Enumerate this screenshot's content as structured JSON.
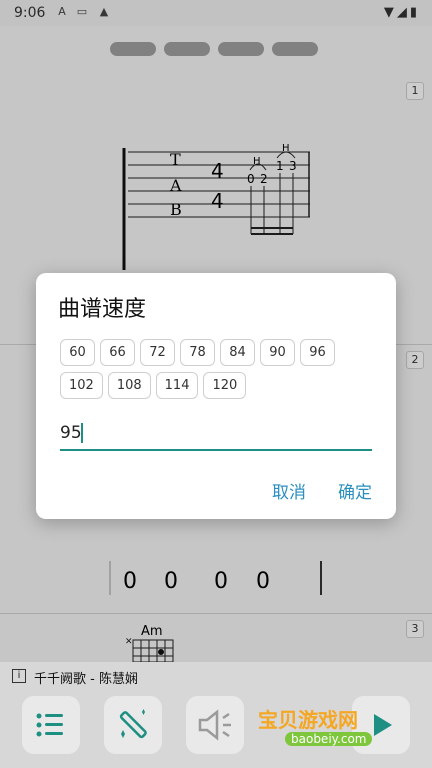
{
  "status": {
    "time": "9:06"
  },
  "pages": [
    {
      "id": 1
    },
    {
      "id": 2
    },
    {
      "id": 3
    },
    {
      "id": 4
    }
  ],
  "bars": [
    {
      "num": "1"
    },
    {
      "num": "2"
    },
    {
      "num": "3"
    }
  ],
  "tab_letters": [
    "T",
    "A",
    "B"
  ],
  "time_sig": [
    "4",
    "4"
  ],
  "fret_notes": [
    "0",
    "2",
    "1",
    "3"
  ],
  "hammer": [
    "H",
    "H"
  ],
  "rest_notes": [
    "0",
    "0",
    "0",
    "0"
  ],
  "chord": "Am",
  "dialog": {
    "title": "曲谱速度",
    "options": [
      "60",
      "66",
      "72",
      "78",
      "84",
      "90",
      "96",
      "102",
      "108",
      "114",
      "120"
    ],
    "value": "95",
    "cancel": "取消",
    "confirm": "确定"
  },
  "song": {
    "info_icon": "i",
    "title": "千千阙歌 - 陈慧娴"
  },
  "toolbar": [
    {
      "icon": "list-icon"
    },
    {
      "icon": "magic-wand-icon"
    },
    {
      "icon": "speaker-icon"
    },
    {
      "icon": "play-icon"
    }
  ],
  "watermark": {
    "line1": "宝贝游戏网",
    "line2": "baobeiy.com"
  }
}
